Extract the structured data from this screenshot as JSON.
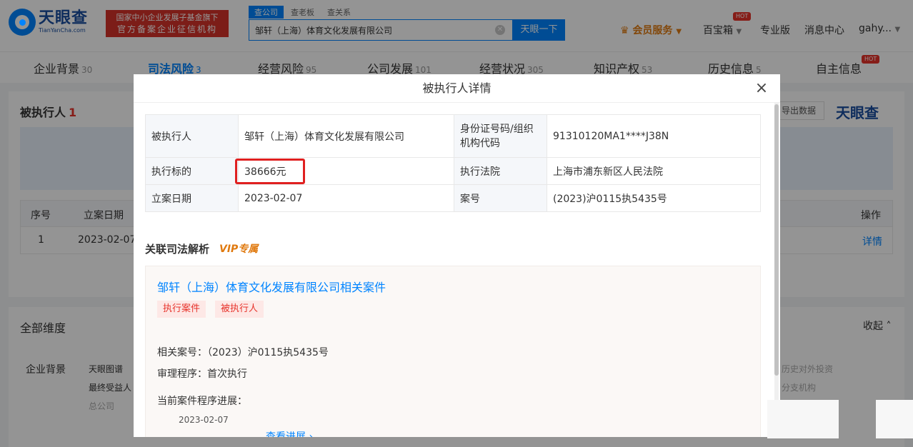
{
  "header": {
    "logo_cn": "天眼查",
    "logo_en": "TianYanCha.com",
    "badge_line1": "国家中小企业发展子基金旗下",
    "badge_line2": "官方备案企业征信机构",
    "search_tabs": [
      "查公司",
      "查老板",
      "查关系"
    ],
    "search_value": "邹轩（上海）体育文化发展有限公司",
    "search_button": "天眼一下",
    "vip_service": "会员服务",
    "toolbox": "百宝箱",
    "pro": "专业版",
    "messages": "消息中心",
    "user": "gahy...",
    "hot": "HOT"
  },
  "tabs": [
    {
      "label": "企业背景",
      "count": "30"
    },
    {
      "label": "司法风险",
      "count": "3"
    },
    {
      "label": "经营风险",
      "count": "95"
    },
    {
      "label": "公司发展",
      "count": "101"
    },
    {
      "label": "经营状况",
      "count": "305"
    },
    {
      "label": "知识产权",
      "count": "53"
    },
    {
      "label": "历史信息",
      "count": "5"
    },
    {
      "label": "自主信息",
      "count": ""
    }
  ],
  "section": {
    "title": "被执行人",
    "count": "1",
    "export": "导出数据",
    "brand": "天眼查",
    "table_headers": {
      "index": "序号",
      "date": "立案日期",
      "action": "操作"
    },
    "row": {
      "index": "1",
      "date": "2023-02-07",
      "action": "详情"
    }
  },
  "dimensions": {
    "title": "全部维度",
    "collapse": "收起",
    "category": "企业背景",
    "items": [
      "天眼图谱",
      "最终受益人",
      "总公司"
    ],
    "right_items": [
      "历史对外投资",
      "分支机构"
    ]
  },
  "modal": {
    "title": "被执行人详情",
    "close": "×",
    "rows": [
      {
        "k1": "被执行人",
        "v1": "邹轩（上海）体育文化发展有限公司",
        "k2": "身份证号码/组织机构代码",
        "v2": "91310120MA1****J38N"
      },
      {
        "k1": "执行标的",
        "v1": "38666元",
        "k2": "执行法院",
        "v2": "上海市浦东新区人民法院"
      },
      {
        "k1": "立案日期",
        "v1": "2023-02-07",
        "k2": "案号",
        "v2": "(2023)沪0115执5435号"
      }
    ],
    "related_title": "关联司法解析",
    "vip_tag": "VIP专属",
    "case": {
      "name": "邹轩（上海）体育文化发展有限公司相关案件",
      "tags": [
        "执行案件",
        "被执行人"
      ],
      "case_no": "相关案号：（2023）沪0115执5435号",
      "procedure": "审理程序：首次执行",
      "progress": "当前案件程序进展：",
      "date": "2023-02-07",
      "more": "查看进展 ›"
    }
  }
}
